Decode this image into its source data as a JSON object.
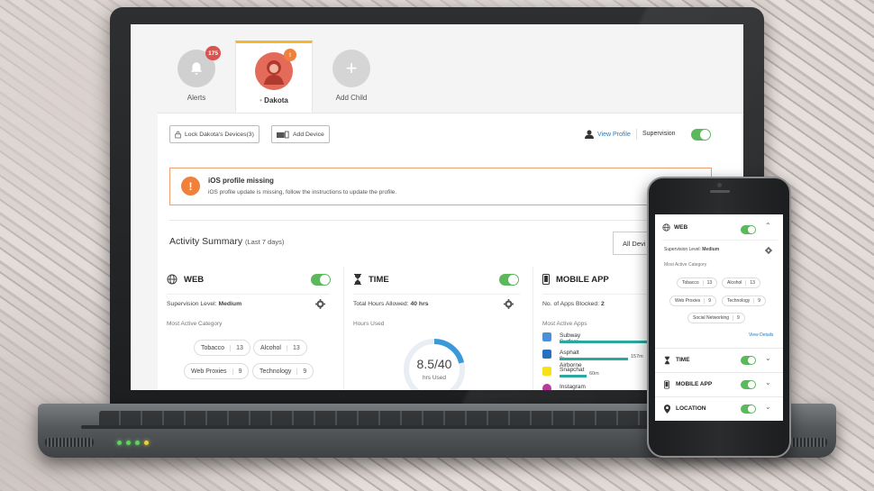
{
  "tabs": [
    {
      "label": "Alerts",
      "badge": "175",
      "icon": "bell-icon"
    },
    {
      "label": "Dakota",
      "badge": "!",
      "icon": "avatar-icon",
      "status_dot": "•"
    },
    {
      "label": "Add Child",
      "icon": "plus-icon"
    }
  ],
  "toolbar": {
    "lock_label": "Lock Dakota's Devices(3)",
    "add_device_label": "Add Device",
    "view_profile_label": "View Profile",
    "supervision_label": "Supervision"
  },
  "alert": {
    "title": "iOS profile missing",
    "message": "iOS profile update is missing, follow the instructions to update the profile.",
    "icon_glyph": "!"
  },
  "activity": {
    "title": "Activity Summary",
    "range": "(Last 7 days)",
    "dropdown_label": "All Devi"
  },
  "web_card": {
    "title": "WEB",
    "supervision_prefix": "Supervision Level:",
    "supervision_value": "Medium",
    "category_label": "Most Active Category",
    "chips": [
      {
        "label": "Tobacco",
        "count": "13"
      },
      {
        "label": "Alcohol",
        "count": "13"
      },
      {
        "label": "Web Proxies",
        "count": "9"
      },
      {
        "label": "Technology",
        "count": "9"
      }
    ]
  },
  "time_card": {
    "title": "TIME",
    "allowed_prefix": "Total Hours Allowed:",
    "allowed_value": "40 hrs",
    "used_label": "Hours Used",
    "gauge_value": "8.5/40",
    "gauge_caption": "hrs Used",
    "gauge_fraction": 0.2125
  },
  "mobile_card": {
    "title": "MOBILE APP",
    "blocked_prefix": "No. of Apps Blocked:",
    "blocked_value": "2",
    "apps_label": "Most Active Apps",
    "apps": [
      {
        "name": "Subway Surfers",
        "time": "",
        "color": "#4a90d9"
      },
      {
        "name": "Asphalt 8: Airborne",
        "time": "157m",
        "color": "#2a6fbf"
      },
      {
        "name": "Snapchat",
        "time": "60m",
        "color": "#f7e018"
      },
      {
        "name": "Instagram",
        "time": "",
        "color": "#b53c9a"
      }
    ]
  },
  "phone": {
    "web": {
      "title": "WEB",
      "supervision_prefix": "Supervision Level:",
      "supervision_value": "Medium",
      "category_label": "Most Active Category",
      "chips": [
        {
          "label": "Tobacco",
          "count": "13"
        },
        {
          "label": "Alcohol",
          "count": "13"
        },
        {
          "label": "Web Proxies",
          "count": "9"
        },
        {
          "label": "Technology",
          "count": "9"
        },
        {
          "label": "Social Networking",
          "count": "9"
        }
      ],
      "view_details": "View Details"
    },
    "sections": [
      {
        "title": "TIME",
        "icon": "hourglass-icon"
      },
      {
        "title": "MOBILE APP",
        "icon": "mobile-icon"
      },
      {
        "title": "LOCATION",
        "icon": "location-pin-icon"
      }
    ]
  },
  "colors": {
    "accent_yellow": "#f5b731",
    "badge_red": "#d9534f",
    "toggle_green": "#5cb85c",
    "alert_orange": "#f0803a",
    "link_blue": "#2a7ab8"
  }
}
